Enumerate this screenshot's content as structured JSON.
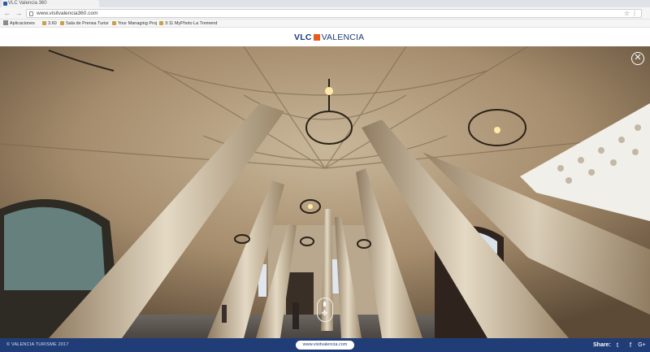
{
  "browser": {
    "tab_title": "VLC Valencia 360",
    "url": "www.visitvalencia360.com",
    "bookmarks": [
      {
        "label": "Aplicaciones",
        "icon": "apps-icon"
      },
      {
        "label": "3.60",
        "icon": "bookmark-icon"
      },
      {
        "label": "Sala de Prensa Turisr",
        "icon": "bookmark-icon"
      },
      {
        "label": "Your Managing Proj",
        "icon": "bookmark-icon"
      },
      {
        "label": "3:11 MyPhoto La Tremend",
        "icon": "bookmark-icon"
      }
    ]
  },
  "site": {
    "logo_left": "VLC",
    "logo_right": "VALENCIA",
    "accent_color": "#e85b1a",
    "brand_color": "#1b3b78"
  },
  "viewer": {
    "close_symbol": "✕",
    "mouse_hint_icon": "mouse-drag-icon"
  },
  "footer": {
    "copyright": "© VALENCIA TURISME 2017",
    "link": "www.visitvalencia.com",
    "share_label": "Share:",
    "social": [
      {
        "name": "twitter-icon",
        "glyph": "t"
      },
      {
        "name": "facebook-icon",
        "glyph": "f"
      },
      {
        "name": "google-plus-icon",
        "glyph": "G+"
      }
    ],
    "bg_color": "#213d77"
  }
}
